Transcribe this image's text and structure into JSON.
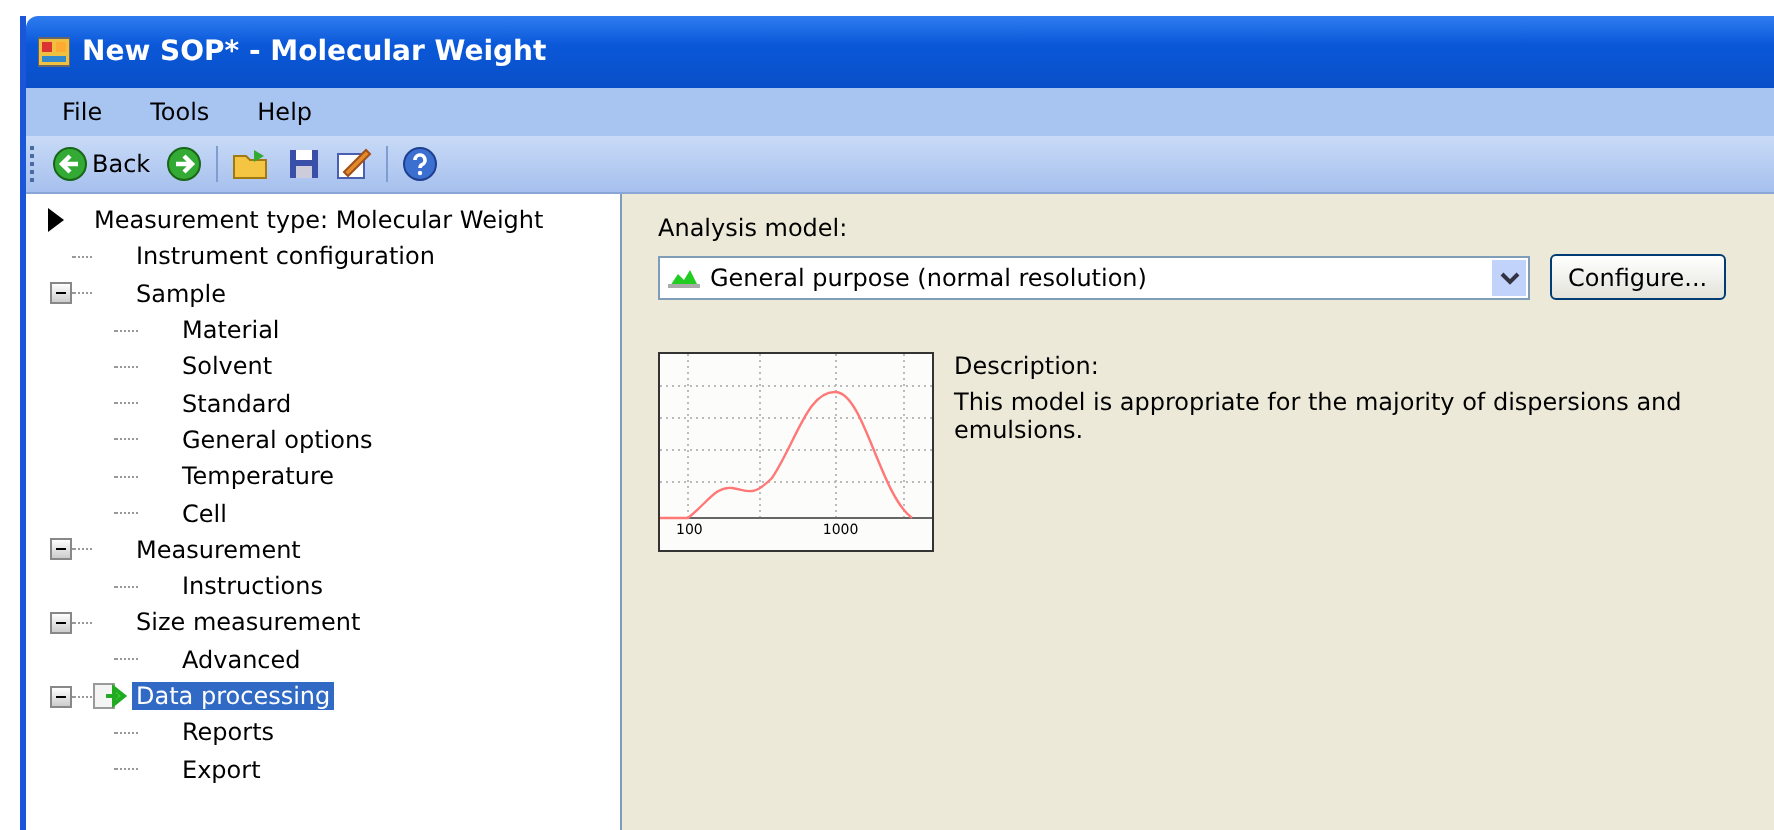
{
  "window": {
    "title": "New SOP* - Molecular Weight"
  },
  "menu": [
    "File",
    "Tools",
    "Help"
  ],
  "toolbar": {
    "back_label": "Back"
  },
  "tree": {
    "label": "Measurement type: Molecular Weight",
    "children": [
      {
        "label": "Instrument configuration",
        "selected": false
      },
      {
        "label": "Sample",
        "selected": false,
        "expanded": true,
        "children": [
          {
            "label": "Material",
            "selected": false
          },
          {
            "label": "Solvent",
            "selected": false
          },
          {
            "label": "Standard",
            "selected": false
          },
          {
            "label": "General options",
            "selected": false
          },
          {
            "label": "Temperature",
            "selected": false
          },
          {
            "label": "Cell",
            "selected": false
          }
        ]
      },
      {
        "label": "Measurement",
        "selected": false,
        "expanded": true,
        "children": [
          {
            "label": "Instructions",
            "selected": false
          }
        ]
      },
      {
        "label": "Size measurement",
        "selected": false,
        "expanded": true,
        "children": [
          {
            "label": "Advanced",
            "selected": false
          }
        ]
      },
      {
        "label": "Data processing",
        "selected": true,
        "expanded": true,
        "children": [
          {
            "label": "Reports",
            "selected": false
          },
          {
            "label": "Export",
            "selected": false
          }
        ]
      }
    ]
  },
  "analysis_model": {
    "label": "Analysis model:",
    "value": "General purpose (normal resolution)",
    "configure_button": "Configure..."
  },
  "preview": {
    "tick_labels": [
      "100",
      "1000"
    ]
  },
  "description": {
    "label": "Description:",
    "text": "This model is appropriate for the majority of dispersions and emulsions."
  }
}
